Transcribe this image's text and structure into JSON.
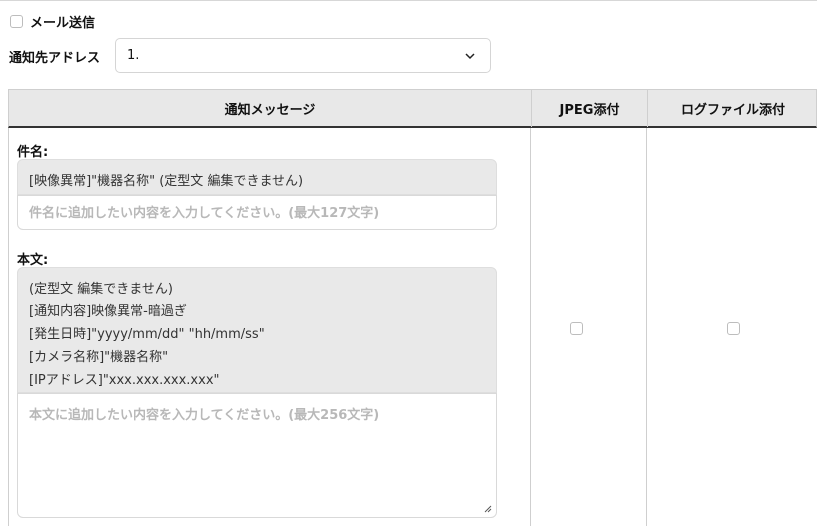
{
  "mail": {
    "label": "メール送信",
    "checked": false
  },
  "address": {
    "label": "通知先アドレス",
    "selected": "1."
  },
  "table": {
    "headers": [
      "通知メッセージ",
      "JPEG添付",
      "ログファイル添付"
    ],
    "subject": {
      "label": "件名:",
      "fixed": "[映像異常]\"機器名称\" (定型文 編集できません)",
      "placeholder": "件名に追加したい内容を入力してください。(最大127文字)"
    },
    "body": {
      "label": "本文:",
      "fixed_lines": [
        "(定型文 編集できません)",
        "[通知内容]映像異常-暗過ぎ",
        "[発生日時]\"yyyy/mm/dd\" \"hh/mm/ss\"",
        "[カメラ名称]\"機器名称\"",
        "[IPアドレス]\"xxx.xxx.xxx.xxx\""
      ],
      "placeholder": "本文に追加したい内容を入力してください。(最大256文字)"
    },
    "jpeg_attach": false,
    "log_attach": false
  }
}
